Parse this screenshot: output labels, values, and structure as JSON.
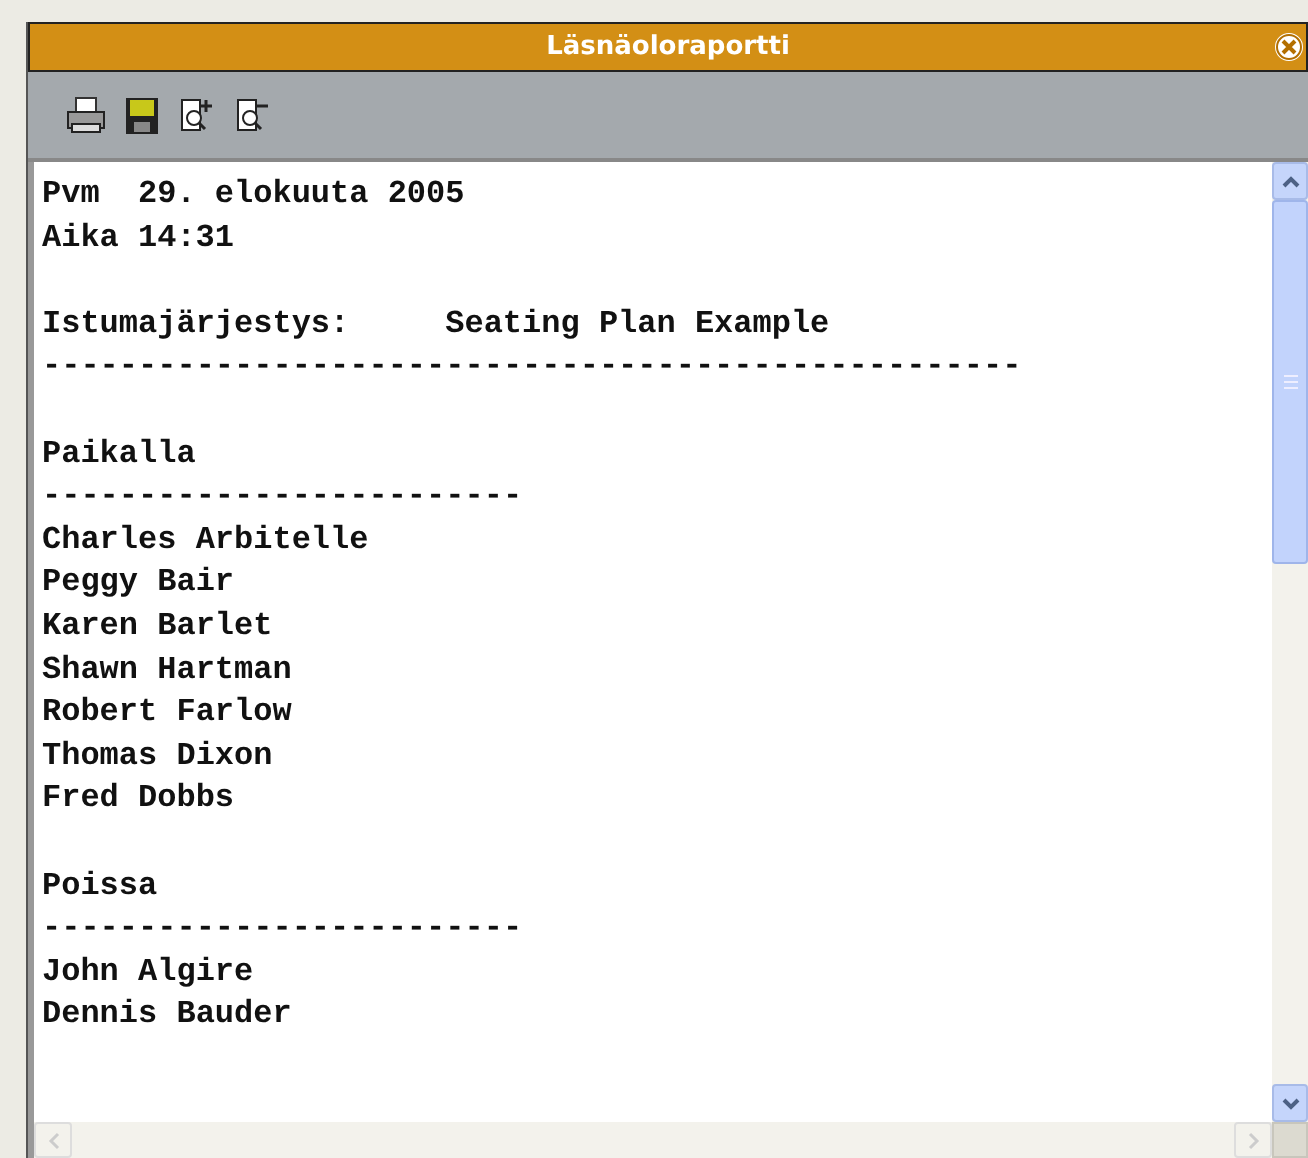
{
  "window": {
    "title": "Läsnäoloraportti"
  },
  "toolbar": [
    {
      "kind": "print"
    },
    {
      "kind": "save"
    },
    {
      "kind": "zoom-in"
    },
    {
      "kind": "zoom-out"
    }
  ],
  "report": [
    {
      "kind": "pair",
      "label": "Pvm",
      "value": "29. elokuuta 2005"
    },
    {
      "kind": "pair",
      "label": "Aika",
      "value": "14:31"
    },
    {
      "kind": "blank"
    },
    {
      "kind": "widepair",
      "label": "Istumajärjestys:",
      "value": "Seating Plan Example"
    },
    {
      "kind": "text",
      "text": "---------------------------------------------------"
    },
    {
      "kind": "blank"
    },
    {
      "kind": "text",
      "text": "Paikalla"
    },
    {
      "kind": "text",
      "text": "-------------------------"
    },
    {
      "kind": "text",
      "text": "Charles Arbitelle"
    },
    {
      "kind": "text",
      "text": "Peggy Bair"
    },
    {
      "kind": "text",
      "text": "Karen Barlet"
    },
    {
      "kind": "text",
      "text": "Shawn Hartman"
    },
    {
      "kind": "text",
      "text": "Robert Farlow"
    },
    {
      "kind": "text",
      "text": "Thomas Dixon"
    },
    {
      "kind": "text",
      "text": "Fred Dobbs"
    },
    {
      "kind": "blank"
    },
    {
      "kind": "text",
      "text": "Poissa"
    },
    {
      "kind": "text",
      "text": "-------------------------"
    },
    {
      "kind": "text",
      "text": "John Algire"
    },
    {
      "kind": "text",
      "text": "Dennis Bauder"
    }
  ]
}
